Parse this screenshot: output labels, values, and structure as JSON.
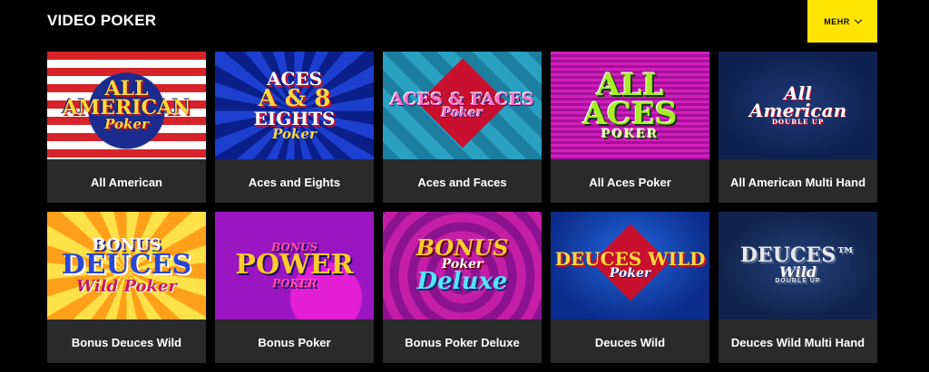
{
  "section": {
    "title": "VIDEO POKER"
  },
  "more_button": {
    "label": "MEHR"
  },
  "games": [
    {
      "name": "All American",
      "art": {
        "line1": "ALL",
        "line2": "AMERICAN",
        "line3": "Poker"
      }
    },
    {
      "name": "Aces and Eights",
      "art": {
        "line1": "ACES",
        "line2": "A & 8",
        "line3": "EIGHTS",
        "line4": "Poker"
      }
    },
    {
      "name": "Aces and Faces",
      "art": {
        "line1": "ACES & FACES",
        "line2": "Poker"
      }
    },
    {
      "name": "All Aces Poker",
      "art": {
        "line1": "ALL",
        "line2": "ACES",
        "line3": "POKER"
      }
    },
    {
      "name": "All American Multi Hand",
      "art": {
        "line1": "All",
        "line2": "American",
        "line3": "DOUBLE UP"
      }
    },
    {
      "name": "Bonus Deuces Wild",
      "art": {
        "line1": "BONUS",
        "line2": "DEUCES",
        "line3": "Wild Poker"
      }
    },
    {
      "name": "Bonus Poker",
      "art": {
        "line1": "BONUS",
        "line2": "POWER",
        "line3": "POKER"
      }
    },
    {
      "name": "Bonus Poker Deluxe",
      "art": {
        "line1": "BONUS",
        "line2": "Poker",
        "line3": "Deluxe"
      }
    },
    {
      "name": "Deuces Wild",
      "art": {
        "line1": "DEUCES WILD",
        "line2": "Poker"
      }
    },
    {
      "name": "Deuces Wild Multi Hand",
      "art": {
        "line1": "DEUCES™",
        "line2": "Wild",
        "line3": "DOUBLE UP"
      }
    }
  ]
}
